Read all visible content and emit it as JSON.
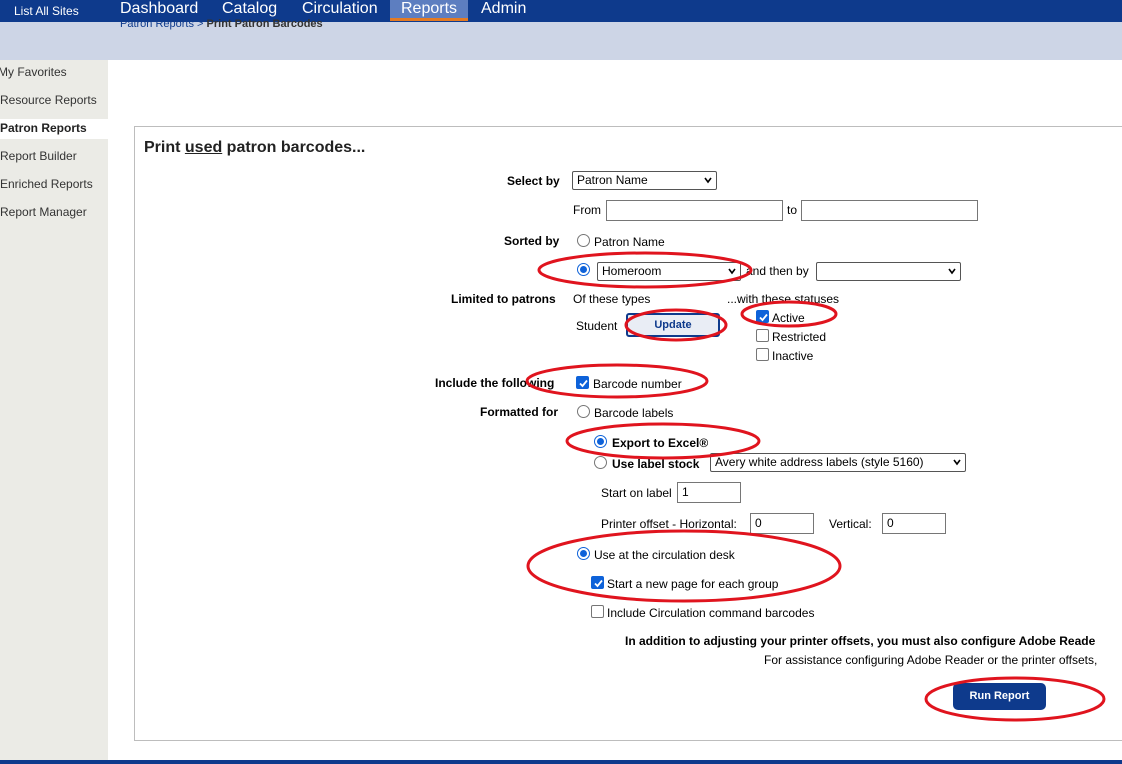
{
  "topnav": {
    "list_all_sites": "List All Sites",
    "items": [
      "Dashboard",
      "Catalog",
      "Circulation",
      "Reports",
      "Admin"
    ],
    "active": "Reports"
  },
  "breadcrumb": {
    "parent": "Patron Reports",
    "separator": " > ",
    "current": "Print Patron Barcodes"
  },
  "sidebar": {
    "items": [
      "My Favorites",
      "Resource Reports",
      "Patron Reports",
      "Report Builder",
      "Enriched Reports",
      "Report Manager"
    ],
    "active": "Patron Reports"
  },
  "form": {
    "title_pre": "Print ",
    "title_underlined": "used",
    "title_post": " patron barcodes...",
    "select_by_label": "Select by",
    "select_by_value": "Patron Name",
    "from_label": "From",
    "to_label": "to",
    "from_value": "",
    "to_value": "",
    "sorted_by_label": "Sorted by",
    "sort_option_1": "Patron Name",
    "sort_select_value": "Homeroom",
    "then_by_label": "and then by",
    "then_by_value": "",
    "limited_label": "Limited to patrons",
    "of_these_types": "Of these types",
    "with_statuses": "...with these statuses",
    "type_value": "Student",
    "update_button": "Update",
    "status_active": "Active",
    "status_restricted": "Restricted",
    "status_inactive": "Inactive",
    "include_label": "Include the following",
    "barcode_number": "Barcode number",
    "formatted_label": "Formatted for",
    "format_barcode_labels": "Barcode labels",
    "format_export_excel": "Export to Excel®",
    "format_label_stock": "Use label stock",
    "label_stock_value": "Avery white address labels (style 5160)",
    "start_on_label": "Start on label",
    "start_on_value": "1",
    "printer_offset_label": "Printer offset - Horizontal:",
    "horizontal_value": "0",
    "vertical_label": "Vertical:",
    "vertical_value": "0",
    "use_circ_desk": "Use at the circulation desk",
    "new_page_each_group": "Start a new page for each group",
    "include_circ_commands": "Include Circulation command barcodes",
    "note_bold": "In addition to adjusting your printer offsets, you must also configure Adobe Reade",
    "note_plain": "For assistance configuring Adobe Reader or the printer offsets,",
    "run_button": "Run Report"
  },
  "state": {
    "sort_homeroom_selected": true,
    "status_active_checked": true,
    "status_restricted_checked": false,
    "status_inactive_checked": false,
    "barcode_number_checked": true,
    "format": "Export to Excel®",
    "use_circ_desk_selected": true,
    "new_page_checked": true,
    "include_circ_commands_checked": false
  },
  "colors": {
    "nav_bg": "#0e3a8c",
    "nav_active_bg": "#5d7ec0",
    "nav_active_underline": "#e37a23",
    "breadcrumb_bg": "#cdd5e6",
    "sidebar_bg": "#ebebe6",
    "annotation_red": "#e0141e",
    "radio_blue": "#0e62d9"
  }
}
